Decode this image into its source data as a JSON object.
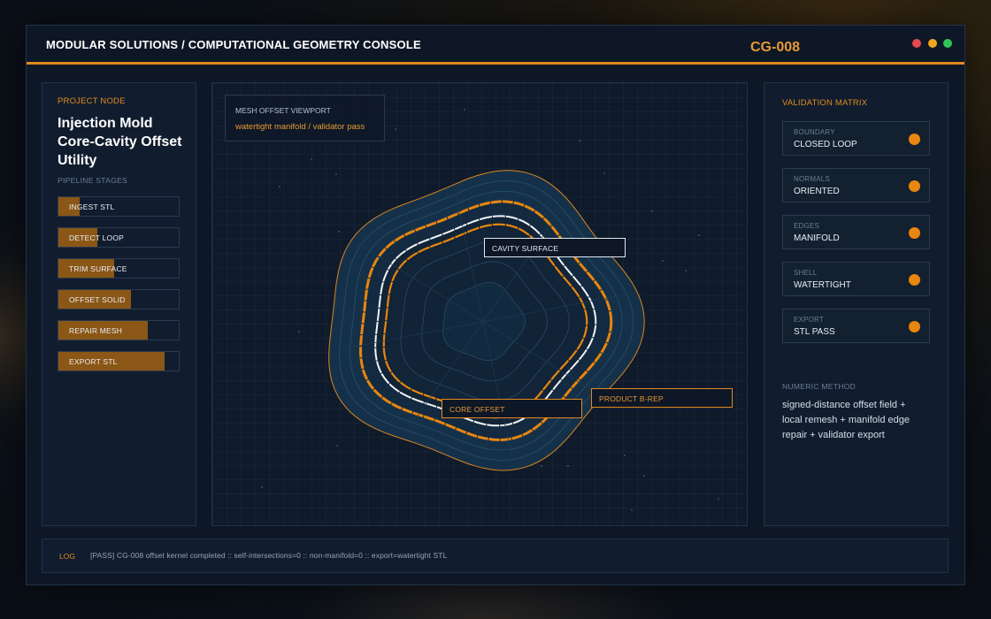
{
  "window": {
    "title": "MODULAR SOLUTIONS / COMPUTATIONAL GEOMETRY CONSOLE",
    "job_id": "CG-008",
    "controls": {
      "close": "#e5484d",
      "minimize": "#f2a81d",
      "maximize": "#30c45a"
    }
  },
  "theme": {
    "accent": "#e08a1e",
    "background": "#0d1726",
    "panel": "#111d2e"
  },
  "project": {
    "section_label": "PROJECT NODE",
    "title": "Injection Mold Core-Cavity Offset Utility",
    "stages_label": "PIPELINE STAGES",
    "stages": [
      {
        "label": "INGEST STL",
        "progress": 0.18
      },
      {
        "label": "DETECT LOOP",
        "progress": 0.32
      },
      {
        "label": "TRIM SURFACE",
        "progress": 0.46
      },
      {
        "label": "OFFSET SOLID",
        "progress": 0.6
      },
      {
        "label": "REPAIR MESH",
        "progress": 0.74
      },
      {
        "label": "EXPORT STL",
        "progress": 0.88
      }
    ]
  },
  "viewport": {
    "title": "MESH OFFSET VIEWPORT",
    "subtitle": "watertight manifold / validator pass",
    "callouts": {
      "cavity": "CAVITY SURFACE",
      "core": "CORE OFFSET",
      "product": "PRODUCT B-REP"
    }
  },
  "validation": {
    "section_label": "VALIDATION MATRIX",
    "items": [
      {
        "key": "BOUNDARY",
        "value": "CLOSED LOOP",
        "status": "#e8860f"
      },
      {
        "key": "NORMALS",
        "value": "ORIENTED",
        "status": "#e8860f"
      },
      {
        "key": "EDGES",
        "value": "MANIFOLD",
        "status": "#e8860f"
      },
      {
        "key": "SHELL",
        "value": "WATERTIGHT",
        "status": "#e8860f"
      },
      {
        "key": "EXPORT",
        "value": "STL PASS",
        "status": "#e8860f"
      }
    ],
    "method_label": "NUMERIC METHOD",
    "method_text": "signed-distance offset field + local remesh + manifold edge repair + validator export"
  },
  "log": {
    "label": "LOG",
    "text": "[PASS] CG-008 offset kernel completed :: self-intersections=0 :: non-manifold=0 :: export=watertight STL"
  }
}
